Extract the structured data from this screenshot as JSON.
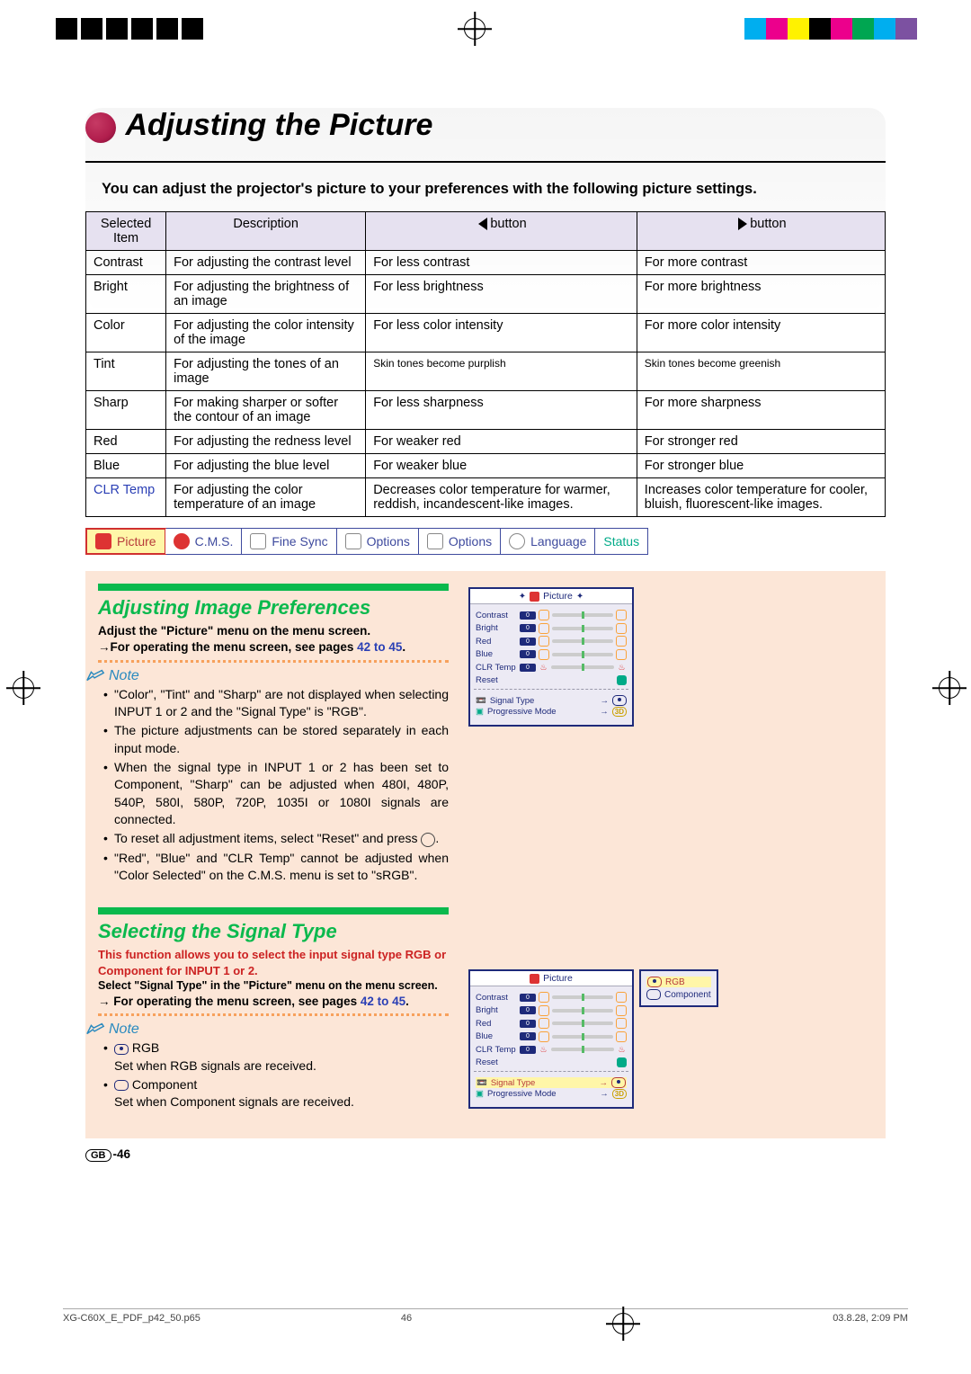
{
  "crop_colors": [
    "#00aeef",
    "#ec008c",
    "#fff200",
    "#000000",
    "#ec008c",
    "#00a651",
    "#00aeef",
    "#7c51a1"
  ],
  "title": "Adjusting the Picture",
  "intro": "You can adjust the projector's picture to your preferences with the following picture settings.",
  "table": {
    "headers": {
      "item": "Selected Item",
      "desc": "Description",
      "left": "button",
      "right": "button"
    },
    "rows": [
      {
        "item": "Contrast",
        "desc": "For adjusting the contrast level",
        "l": "For less contrast",
        "r": "For more contrast"
      },
      {
        "item": "Bright",
        "desc": "For adjusting the brightness of an image",
        "l": "For less brightness",
        "r": "For more brightness"
      },
      {
        "item": "Color",
        "desc": "For adjusting the color intensity of the image",
        "l": "For less color intensity",
        "r": "For more color intensity"
      },
      {
        "item": "Tint",
        "desc": "For adjusting the tones of an image",
        "l": "Skin tones become purplish",
        "r": "Skin tones become greenish"
      },
      {
        "item": "Sharp",
        "desc": "For making sharper or softer the contour of an image",
        "l": "For less sharpness",
        "r": "For more sharpness"
      },
      {
        "item": "Red",
        "desc": "For adjusting the redness level",
        "l": "For weaker red",
        "r": "For stronger red"
      },
      {
        "item": "Blue",
        "desc": "For adjusting the blue level",
        "l": "For weaker blue",
        "r": "For stronger blue"
      },
      {
        "item": "CLR Temp",
        "item_link": true,
        "desc": "For adjusting the color temperature of an image",
        "l": "Decreases color temperature for warmer, reddish, incandescent-like images.",
        "r": "Increases color temperature for cooler, bluish, fluorescent-like images."
      }
    ]
  },
  "tabs": [
    "Picture",
    "C.M.S.",
    "Fine Sync",
    "Options",
    "Options",
    "Language",
    "Status"
  ],
  "sec1": {
    "title": "Adjusting Image Preferences",
    "line1": "Adjust the \"Picture\" menu on the menu screen.",
    "line2_pre": "→For operating the menu screen, see pages ",
    "line2_link": "42 to 45",
    "note_label": "Note",
    "notes": [
      "\"Color\", \"Tint\" and \"Sharp\" are not displayed when selecting INPUT 1 or 2 and the \"Signal Type\" is \"RGB\".",
      "The picture adjustments can be stored separately in each input mode.",
      "When the signal type in INPUT 1 or 2 has been set to Component, \"Sharp\" can be adjusted when 480I, 480P, 540P, 580I, 580P, 720P, 1035I or 1080I signals are connected.",
      "To reset all adjustment items, select \"Reset\" and press ⊚.",
      "\"Red\", \"Blue\" and \"CLR Temp\" cannot be adjusted when \"Color Selected\" on the C.M.S. menu is set to \"sRGB\"."
    ]
  },
  "sec2": {
    "title": "Selecting the Signal Type",
    "red": "This function allows you to select the input signal type RGB or Component for INPUT 1 or 2.",
    "line1": "Select \"Signal Type\" in the \"Picture\" menu on the menu screen.",
    "line2_pre": "→ For operating the menu screen, see pages ",
    "line2_link": "42 to 45",
    "note_label": "Note",
    "row1a": "RGB",
    "row1b": "Set when RGB signals are received.",
    "row2a": "Component",
    "row2b": "Set when Component signals are received."
  },
  "osd": {
    "head": "Picture",
    "rows": [
      "Contrast",
      "Bright",
      "Red",
      "Blue",
      "CLR Temp"
    ],
    "reset": "Reset",
    "sig": "Signal Type",
    "prog": "Progressive Mode",
    "popup": {
      "a": "RGB",
      "b": "Component"
    }
  },
  "page_num_prefix": "GB",
  "page_num": "-46",
  "footer": {
    "file": "XG-C60X_E_PDF_p42_50.p65",
    "page": "46",
    "date": "03.8.28, 2:09 PM"
  }
}
